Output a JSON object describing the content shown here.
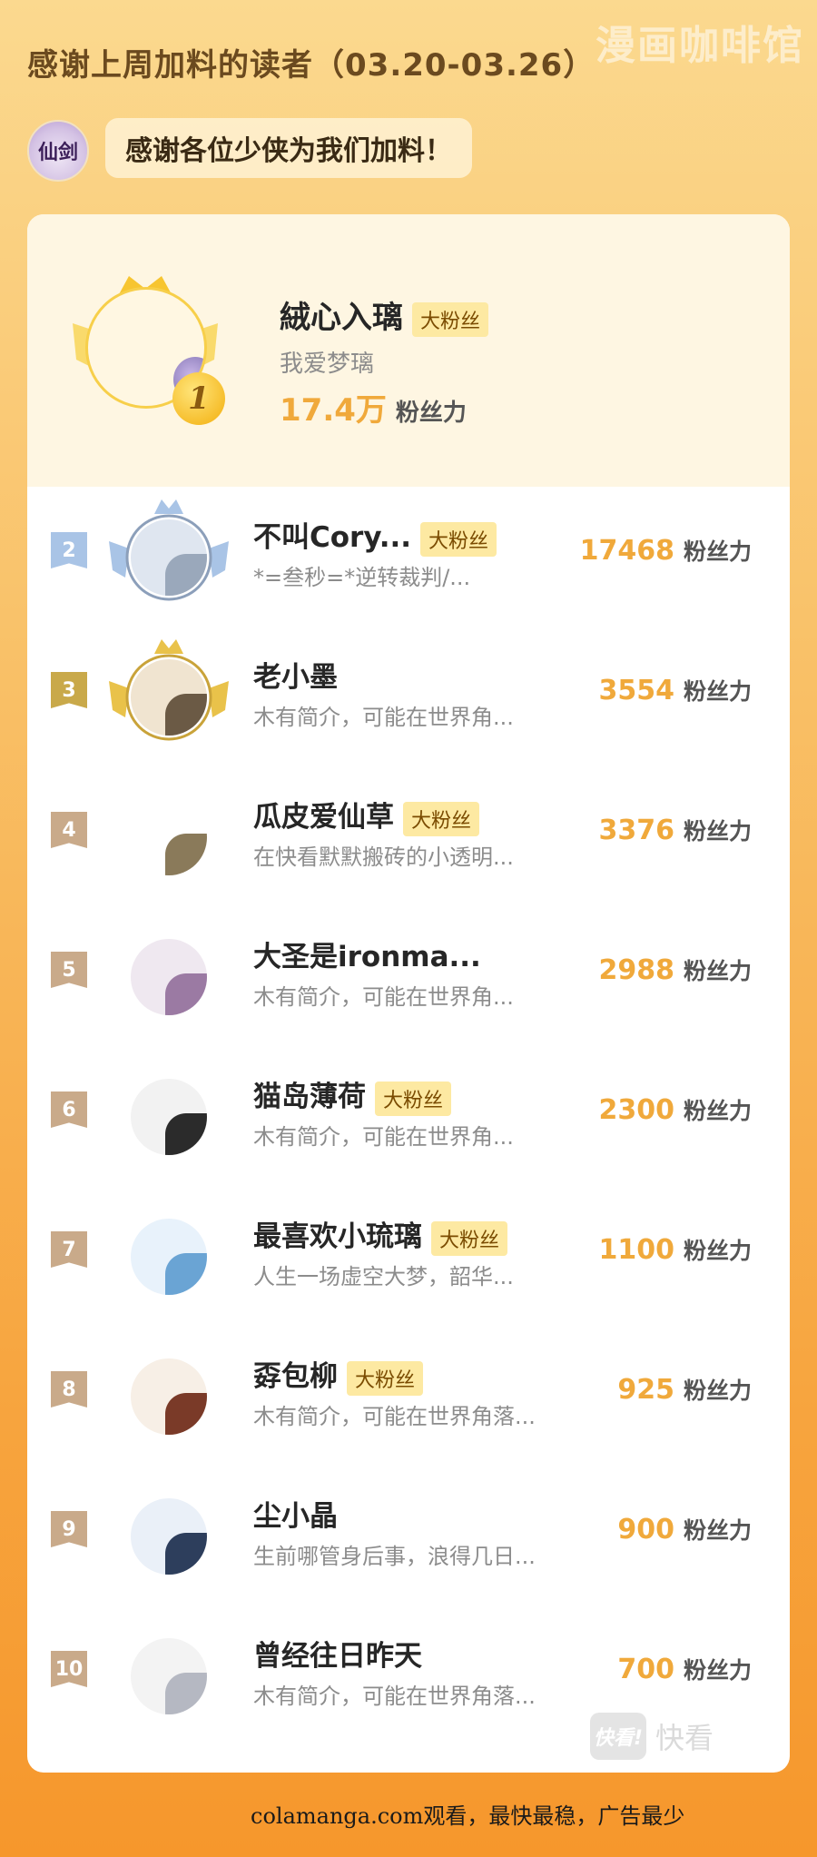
{
  "watermark_top": "漫画咖啡馆",
  "header": {
    "title": "感谢上周加料的读者（03.20-03.26）",
    "logo_text": "仙剑",
    "thanks": "感谢各位少侠为我们加料！"
  },
  "top_fan": {
    "rank": "1",
    "name": "絨心入璃",
    "tag": "大粉丝",
    "subtitle": "我爱梦璃",
    "score": "17.4万",
    "unit": "粉丝力"
  },
  "rows": [
    {
      "rank": "2",
      "name": "不叫Cory...",
      "tag": "大粉丝",
      "subtitle": "*=叁秒=*逆转裁判/...",
      "score": "17468",
      "unit": "粉丝力"
    },
    {
      "rank": "3",
      "name": "老小墨",
      "tag": "",
      "subtitle": "木有简介，可能在世界角...",
      "score": "3554",
      "unit": "粉丝力"
    },
    {
      "rank": "4",
      "name": "瓜皮爱仙草",
      "tag": "大粉丝",
      "subtitle": "在快看默默搬砖的小透明...",
      "score": "3376",
      "unit": "粉丝力"
    },
    {
      "rank": "5",
      "name": "大圣是ironma...",
      "tag": "",
      "subtitle": "木有简介，可能在世界角...",
      "score": "2988",
      "unit": "粉丝力"
    },
    {
      "rank": "6",
      "name": "猫岛薄荷",
      "tag": "大粉丝",
      "subtitle": "木有简介，可能在世界角...",
      "score": "2300",
      "unit": "粉丝力"
    },
    {
      "rank": "7",
      "name": "最喜欢小琉璃",
      "tag": "大粉丝",
      "subtitle": "人生一场虚空大梦，韶华...",
      "score": "1100",
      "unit": "粉丝力"
    },
    {
      "rank": "8",
      "name": "孬包柳",
      "tag": "大粉丝",
      "subtitle": "木有简介，可能在世界角落...",
      "score": "925",
      "unit": "粉丝力"
    },
    {
      "rank": "9",
      "name": "尘小晶",
      "tag": "",
      "subtitle": "生前哪管身后事，浪得几日...",
      "score": "900",
      "unit": "粉丝力"
    },
    {
      "rank": "10",
      "name": "曾经往日昨天",
      "tag": "",
      "subtitle": "木有简介，可能在世界角落...",
      "score": "700",
      "unit": "粉丝力"
    }
  ],
  "watermark_bottom": {
    "box": "快看!",
    "text": "快看"
  },
  "footer": "colamanga.com观看，最快最稳，广告最少",
  "colors": {
    "accent_score": "#f0a93b",
    "tag_bg": "#fde9a2",
    "rank2": "#a9c4e6",
    "rank3": "#c9a94a",
    "rank_other": "#c9aa8a"
  }
}
